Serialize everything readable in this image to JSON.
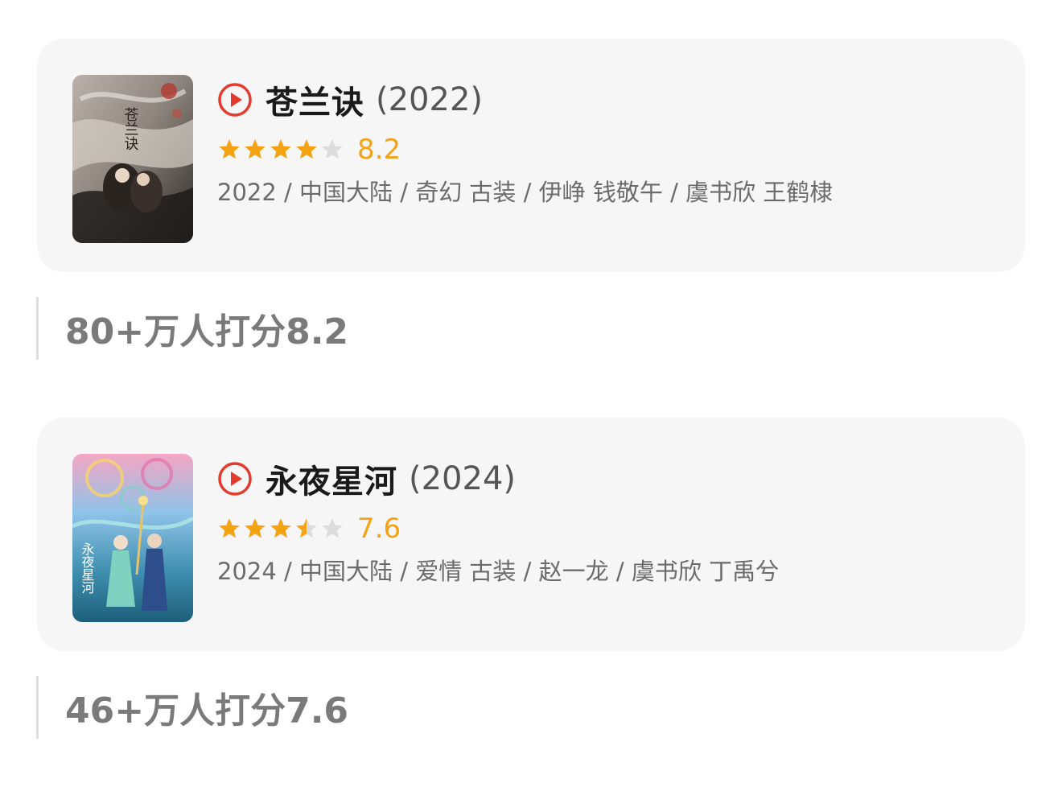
{
  "items": [
    {
      "title": "苍兰诀",
      "year": "(2022)",
      "rating": 8.2,
      "stars": 4,
      "score_text": "8.2",
      "meta": "2022 / 中国大陆 / 奇幻 古装 / 伊峥 钱敬午 / 虞书欣 王鹤棣",
      "poster_caption": "苍兰诀",
      "caption": "80+万人打分8.2"
    },
    {
      "title": "永夜星河",
      "year": "(2024)",
      "rating": 7.6,
      "stars": 3.5,
      "score_text": "7.6",
      "meta": "2024 / 中国大陆 / 爱情 古装 / 赵一龙 / 虞书欣 丁禹兮",
      "poster_caption": "永夜星河",
      "caption": "46+万人打分7.6"
    }
  ],
  "icons": {
    "play": "play-circle-icon",
    "star": "star-icon"
  },
  "colors": {
    "star_filled": "#f5a214",
    "star_empty": "#dcdcdc",
    "play_red": "#e33b2e",
    "card_bg": "#f6f6f6"
  }
}
